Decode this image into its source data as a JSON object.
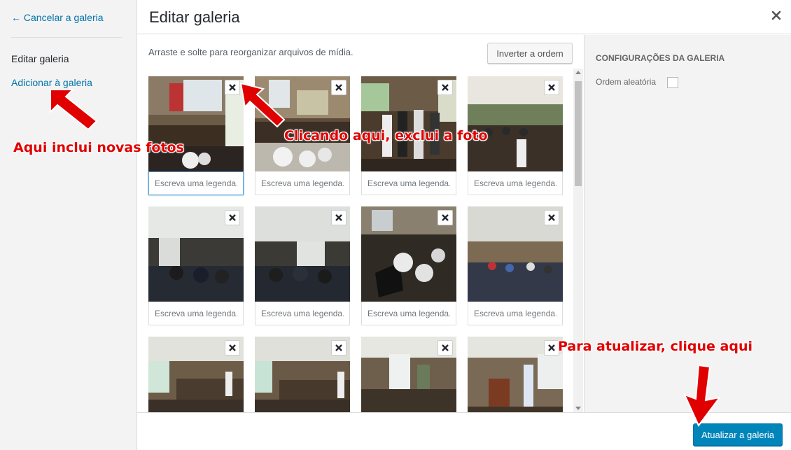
{
  "menu": {
    "cancel_label": "← Cancelar a galeria",
    "edit_label": "Editar galeria",
    "add_label": "Adicionar à galeria"
  },
  "header": {
    "title": "Editar galeria",
    "close_icon": "close-icon"
  },
  "content": {
    "instructions": "Arraste e solte para reorganizar arquivos de mídia.",
    "reverse_label": "Inverter a ordem",
    "caption_placeholder": "Escreva uma legenda...",
    "items": [
      {
        "photo": "room-exhibit-with-banner",
        "delete_icon": "close-icon"
      },
      {
        "photo": "exhibit-table-white-objects",
        "delete_icon": "close-icon"
      },
      {
        "photo": "people-standing-front",
        "delete_icon": "close-icon"
      },
      {
        "photo": "audience-seated-standing",
        "delete_icon": "close-icon"
      },
      {
        "photo": "standing-crowd-dark",
        "delete_icon": "close-icon"
      },
      {
        "photo": "standing-crowd-dark-2",
        "delete_icon": "close-icon"
      },
      {
        "photo": "white-objects-closeup",
        "delete_icon": "close-icon"
      },
      {
        "photo": "audience-seated-speaker",
        "delete_icon": "close-icon"
      },
      {
        "photo": "presentation-room-1",
        "delete_icon": "close-icon"
      },
      {
        "photo": "presentation-room-2",
        "delete_icon": "close-icon"
      },
      {
        "photo": "speaker-at-window",
        "delete_icon": "close-icon"
      },
      {
        "photo": "speaker-at-screen",
        "delete_icon": "close-icon"
      }
    ]
  },
  "settings": {
    "heading": "Configurações da galeria",
    "random_label": "Ordem aleatória",
    "random_checked": false
  },
  "toolbar": {
    "update_label": "Atualizar a galeria"
  },
  "annotations": {
    "add_note": "Aqui inclui novas fotos",
    "delete_note": "Clicando aqui, exclui a foto",
    "update_note": "Para atualizar, clique aqui",
    "arrow_color": "#e00000"
  },
  "colors": {
    "link": "#0073aa",
    "primary_button": "#0085ba",
    "sidebar_bg": "#f3f3f3"
  }
}
